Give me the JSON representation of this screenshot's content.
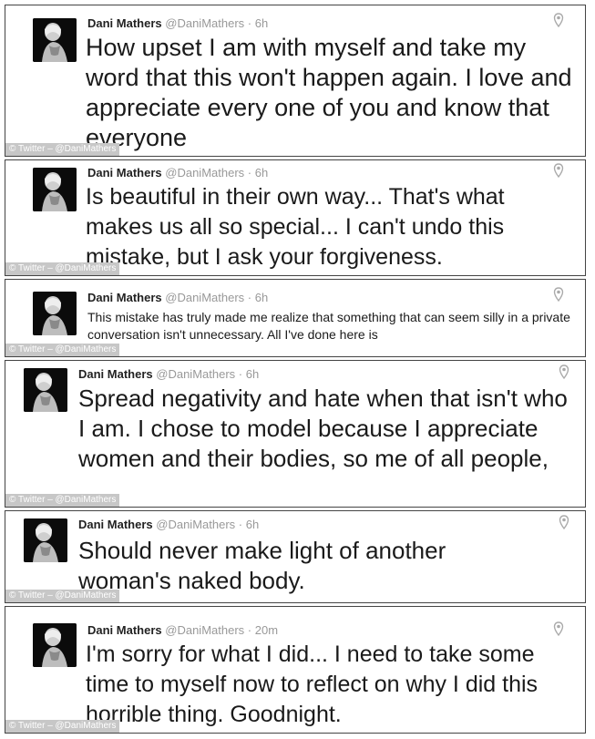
{
  "watermark": "© Twitter – @DaniMathers",
  "tweets": [
    {
      "name": "Dani Mathers",
      "handle": "@DaniMathers",
      "sep": "·",
      "time": "6h",
      "text": "How upset I am with myself and take my word that this won't happen again. I love and appreciate every one of you and know that everyone"
    },
    {
      "name": "Dani Mathers",
      "handle": "@DaniMathers",
      "sep": "·",
      "time": "6h",
      "text": "Is beautiful in their own way... That's what makes us all so special... I can't undo this mistake, but I ask your forgiveness."
    },
    {
      "name": "Dani Mathers",
      "handle": "@DaniMathers",
      "sep": "·",
      "time": "6h",
      "text": "This mistake has truly made me realize that something that can seem silly in a private conversation isn't unnecessary. All I've done here is"
    },
    {
      "name": "Dani Mathers",
      "handle": "@DaniMathers",
      "sep": "·",
      "time": "6h",
      "text": "Spread negativity and hate when that isn't who I am. I chose to model because I appreciate women and their bodies, so me of all people,"
    },
    {
      "name": "Dani Mathers",
      "handle": "@DaniMathers",
      "sep": "·",
      "time": "6h",
      "text": "Should never make light of another woman's naked body."
    },
    {
      "name": "Dani Mathers",
      "handle": "@DaniMathers",
      "sep": "·",
      "time": "20m",
      "text": "I'm sorry for what I did... I need to take some time to myself now to reflect on why I did this horrible thing. Goodnight."
    }
  ]
}
